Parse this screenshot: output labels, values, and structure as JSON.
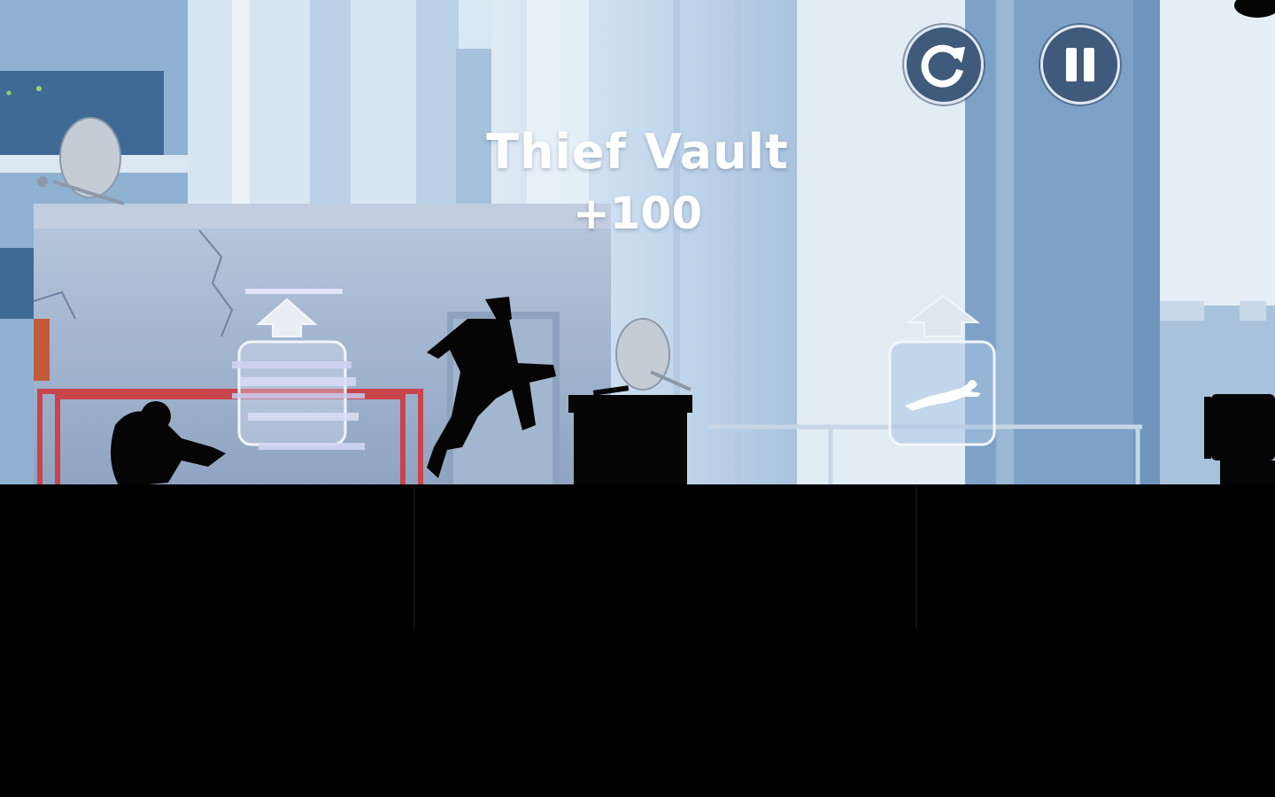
{
  "hud": {
    "restart_icon": "restart-icon",
    "pause_icon": "pause-icon"
  },
  "trick": {
    "name": "Thief Vault",
    "points": "+100"
  },
  "prompts": [
    {
      "icon": "arrow-up-icon",
      "action": "jump",
      "state": "activating"
    },
    {
      "icon": "arrow-up-icon",
      "action": "dive",
      "state": "idle"
    }
  ],
  "colors": {
    "sky": "#cfe3f1",
    "building_light": "#c9dcec",
    "building_mid": "#9fbbd6",
    "rooftop_wall": "#a7b9d3",
    "railing_red": "#c9444b",
    "ground": "#000000",
    "hud_button": "#3f5a7a",
    "hud_ring": "#dfe8f2",
    "text": "#ffffff"
  }
}
